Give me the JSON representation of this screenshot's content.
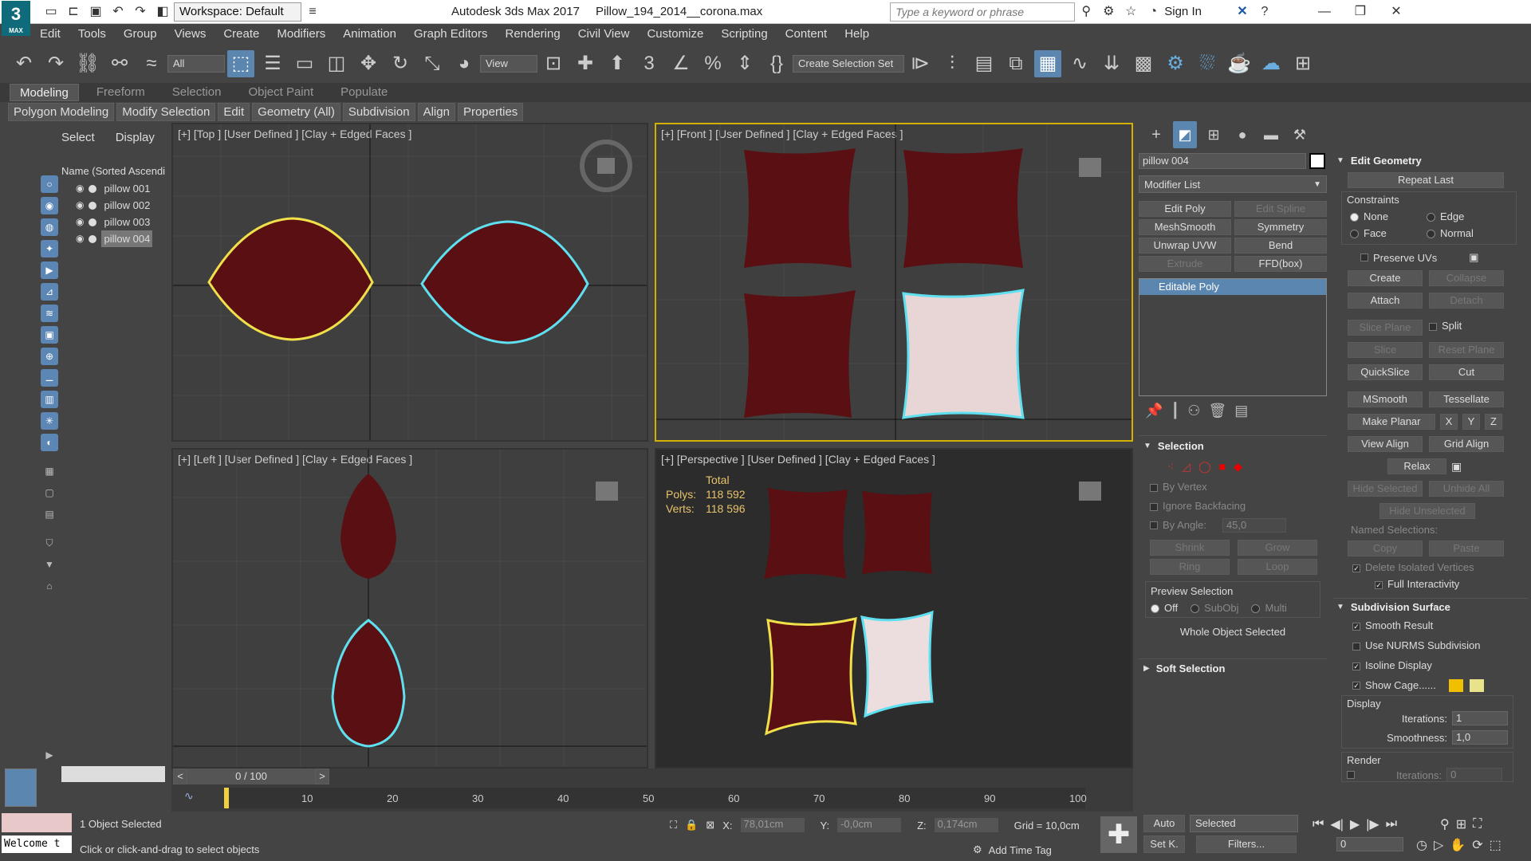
{
  "titlebar": {
    "app_title": "Autodesk 3ds Max 2017",
    "file": "Pillow_194_2014__corona.max",
    "workspace": "Workspace: Default",
    "search_placeholder": "Type a keyword or phrase",
    "sign_in": "Sign In"
  },
  "logo": {
    "big": "3",
    "small": "MAX"
  },
  "menu": [
    "Edit",
    "Tools",
    "Group",
    "Views",
    "Create",
    "Modifiers",
    "Animation",
    "Graph Editors",
    "Rendering",
    "Civil View",
    "Customize",
    "Scripting",
    "Content",
    "Help"
  ],
  "toolbar": {
    "filter": "All",
    "view": "View",
    "selection_set": "Create Selection Set"
  },
  "ribbon_tabs": [
    "Modeling",
    "Freeform",
    "Selection",
    "Object Paint",
    "Populate"
  ],
  "ribbon_sub": [
    "Polygon Modeling",
    "Modify Selection",
    "Edit",
    "Geometry (All)",
    "Subdivision",
    "Align",
    "Properties"
  ],
  "scene": {
    "tab_select": "Select",
    "tab_display": "Display",
    "column": "Name (Sorted Ascendi",
    "objects": [
      "pillow 001",
      "pillow 002",
      "pillow 003",
      "pillow 004"
    ]
  },
  "viewports": {
    "top": "[+] [Top ] [User Defined ] [Clay + Edged Faces ]",
    "front": "[+] [Front ] [User Defined ] [Clay + Edged Faces ]",
    "left": "[+] [Left ] [User Defined ] [Clay + Edged Faces ]",
    "persp": "[+] [Perspective ] [User Defined ] [Clay + Edged Faces ]"
  },
  "stats": {
    "total": "Total",
    "polys_label": "Polys:",
    "polys": "118 592",
    "verts_label": "Verts:",
    "verts": "118 596"
  },
  "cmd": {
    "object_name": "pillow 004",
    "modifier_list": "Modifier List",
    "buttons": [
      "Edit Poly",
      "Edit Spline",
      "MeshSmooth",
      "Symmetry",
      "Unwrap UVW",
      "Bend",
      "Extrude",
      "FFD(box)"
    ],
    "stack_item": "Editable Poly"
  },
  "selection": {
    "title": "Selection",
    "by_vertex": "By Vertex",
    "ignore_backfacing": "Ignore Backfacing",
    "by_angle": "By Angle:",
    "angle": "45,0",
    "shrink": "Shrink",
    "grow": "Grow",
    "ring": "Ring",
    "loop": "Loop",
    "preview": "Preview Selection",
    "off": "Off",
    "subobj": "SubObj",
    "multi": "Multi",
    "status": "Whole Object Selected",
    "soft": "Soft Selection"
  },
  "edit_geometry": {
    "title": "Edit Geometry",
    "repeat_last": "Repeat Last",
    "constraints": "Constraints",
    "none": "None",
    "edge": "Edge",
    "face": "Face",
    "normal": "Normal",
    "preserve_uvs": "Preserve UVs",
    "create": "Create",
    "collapse": "Collapse",
    "attach": "Attach",
    "detach": "Detach",
    "slice_plane": "Slice Plane",
    "split": "Split",
    "slice": "Slice",
    "reset_plane": "Reset Plane",
    "quickslice": "QuickSlice",
    "cut": "Cut",
    "msmooth": "MSmooth",
    "tessellate": "Tessellate",
    "make_planar": "Make Planar",
    "x": "X",
    "y": "Y",
    "z": "Z",
    "view_align": "View Align",
    "grid_align": "Grid Align",
    "relax": "Relax",
    "hide_selected": "Hide Selected",
    "unhide_all": "Unhide All",
    "hide_unselected": "Hide Unselected",
    "named_selections": "Named Selections:",
    "copy": "Copy",
    "paste": "Paste",
    "delete_isolated": "Delete Isolated Vertices",
    "full_interactivity": "Full Interactivity"
  },
  "subdivision": {
    "title": "Subdivision Surface",
    "smooth_result": "Smooth Result",
    "use_nurms": "Use NURMS Subdivision",
    "isoline": "Isoline Display",
    "show_cage": "Show Cage......",
    "display": "Display",
    "iterations_label": "Iterations:",
    "iterations": "1",
    "smoothness_label": "Smoothness:",
    "smoothness": "1,0",
    "render": "Render",
    "render_iterations": "0"
  },
  "timeline": {
    "frame": "0 / 100",
    "ticks": [
      "10",
      "20",
      "30",
      "40",
      "50",
      "60",
      "70",
      "80",
      "90",
      "100"
    ]
  },
  "status": {
    "selected": "1 Object Selected",
    "hint": "Click or click-and-drag to select objects",
    "welcome": "Welcome t",
    "x_label": "X:",
    "x": "78,01cm",
    "y_label": "Y:",
    "y": "-0,0cm",
    "z_label": "Z:",
    "z": "0,174cm",
    "grid": "Grid = 10,0cm",
    "add_time_tag": "Add Time Tag",
    "auto": "Auto",
    "set_key": "Set K.",
    "selected_dd": "Selected",
    "filters": "Filters...",
    "frame_field": "0"
  },
  "colors": {
    "accent": "#5b86b0",
    "pillow": "#5a0f12",
    "yellow": "#f0e04a",
    "cyan": "#5ee0f0",
    "front_border": "#d4b000"
  }
}
